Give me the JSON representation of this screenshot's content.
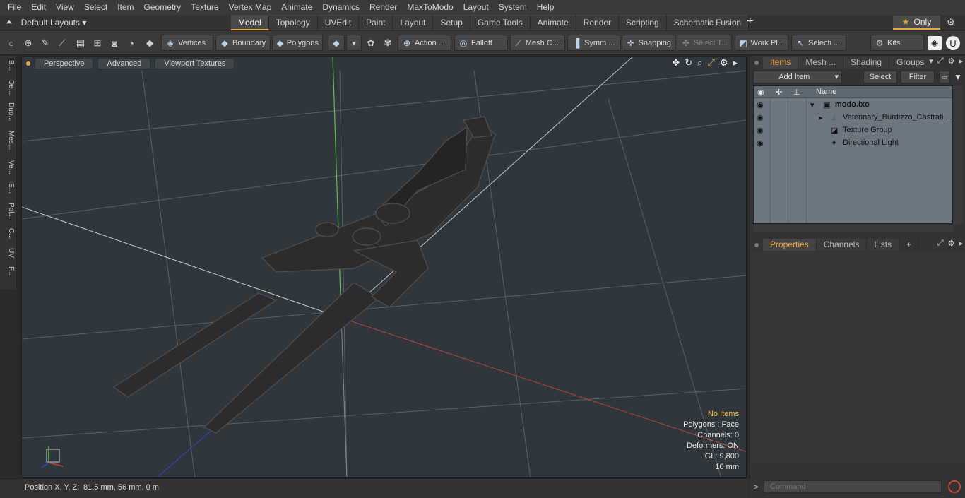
{
  "menu": [
    "File",
    "Edit",
    "View",
    "Select",
    "Item",
    "Geometry",
    "Texture",
    "Vertex Map",
    "Animate",
    "Dynamics",
    "Render",
    "MaxToModo",
    "Layout",
    "System",
    "Help"
  ],
  "layouts": {
    "label": "Default Layouts ▾"
  },
  "tabs": [
    "Model",
    "Topology",
    "UVEdit",
    "Paint",
    "Layout",
    "Setup",
    "Game Tools",
    "Animate",
    "Render",
    "Scripting",
    "Schematic Fusion"
  ],
  "active_tab": "Model",
  "only_label": "Only",
  "toolbar": {
    "vertices": "Vertices",
    "boundary": "Boundary",
    "polygons": "Polygons",
    "action": "Action ...",
    "falloff": "Falloff",
    "mesh": "Mesh C ...",
    "symm": "Symm ...",
    "snapping": "Snapping",
    "select_t": "Select T...",
    "workpl": "Work Pl...",
    "selecti": "Selecti ...",
    "kits": "Kits"
  },
  "left_tabs": [
    "B...",
    "De...",
    "Dup...",
    "Mes...",
    "Ve...",
    "E...",
    "Pol...",
    "C...",
    "UV",
    "F..."
  ],
  "viewport": {
    "perspective": "Perspective",
    "advanced": "Advanced",
    "textures": "Viewport Textures",
    "info": {
      "no_items": "No Items",
      "polygons": "Polygons : Face",
      "channels": "Channels: 0",
      "deformers": "Deformers: ON",
      "gl": "GL: 9,800",
      "scale": "10 mm"
    }
  },
  "status": {
    "label": "Position X, Y, Z:",
    "value": "81.5 mm, 56 mm, 0 m"
  },
  "items_panel": {
    "tabs": [
      "Items",
      "Mesh ...",
      "Shading",
      "Groups"
    ],
    "add_item": "Add Item",
    "select": "Select",
    "filter": "Filter",
    "col_name": "Name",
    "rows": [
      {
        "label": "modo.lxo"
      },
      {
        "label": "Veterinary_Burdizzo_Castrati ..."
      },
      {
        "label": "Texture Group"
      },
      {
        "label": "Directional Light"
      }
    ]
  },
  "props_panel": {
    "tabs": [
      "Properties",
      "Channels",
      "Lists"
    ]
  },
  "command": {
    "placeholder": "Command"
  },
  "colors": {
    "accent": "#e5a83a",
    "list_bg": "#6b7680",
    "viewport_bg": "#30373c"
  }
}
